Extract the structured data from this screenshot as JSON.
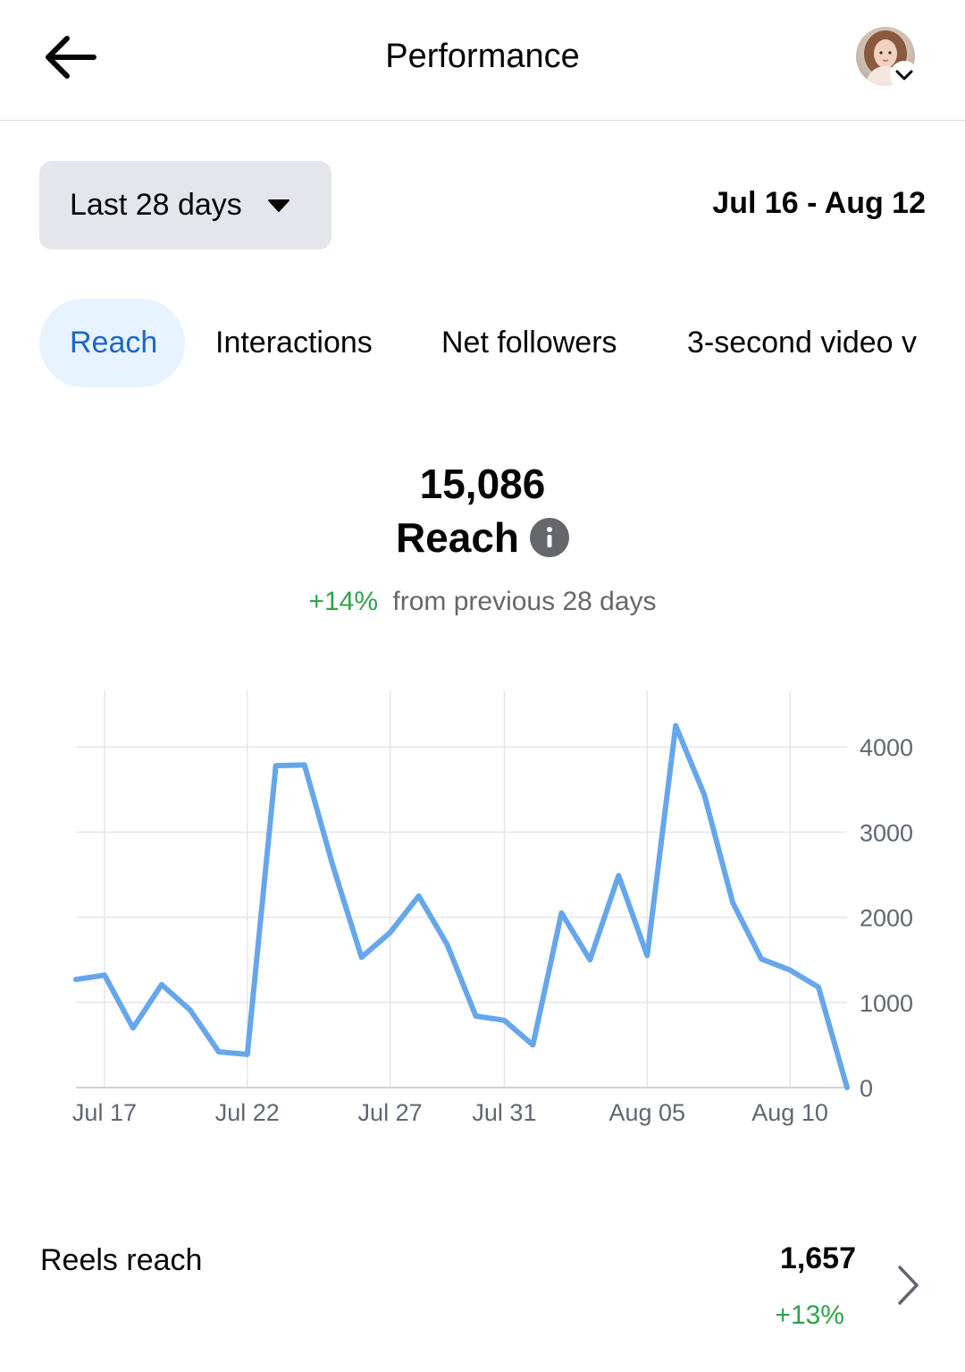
{
  "header": {
    "title": "Performance",
    "back_icon": "arrow-left-icon",
    "profile_menu_icon": "chevron-down-icon"
  },
  "filters": {
    "range_label": "Last 28 days",
    "date_range": "Jul 16 - Aug 12"
  },
  "tabs": [
    {
      "label": "Reach",
      "active": true
    },
    {
      "label": "Interactions",
      "active": false
    },
    {
      "label": "Net followers",
      "active": false
    },
    {
      "label": "3-second video v",
      "active": false
    }
  ],
  "metric": {
    "value": "15,086",
    "name": "Reach",
    "change_pct": "+14%",
    "change_text": "from previous 28 days"
  },
  "colors": {
    "accent": "#1b66c9",
    "active_tab_bg": "#e7f3ff",
    "positive": "#31a24c",
    "line": "#66a6ec"
  },
  "chart_data": {
    "type": "line",
    "x": [
      "Jul 16",
      "Jul 17",
      "Jul 18",
      "Jul 19",
      "Jul 20",
      "Jul 21",
      "Jul 22",
      "Jul 23",
      "Jul 24",
      "Jul 25",
      "Jul 26",
      "Jul 27",
      "Jul 28",
      "Jul 29",
      "Jul 30",
      "Jul 31",
      "Aug 01",
      "Aug 02",
      "Aug 03",
      "Aug 04",
      "Aug 05",
      "Aug 06",
      "Aug 07",
      "Aug 08",
      "Aug 09",
      "Aug 10",
      "Aug 11",
      "Aug 12"
    ],
    "series": [
      {
        "values": [
          1270,
          1320,
          700,
          1210,
          910,
          420,
          390,
          3780,
          3790,
          2600,
          1530,
          1820,
          2250,
          1680,
          840,
          790,
          500,
          2050,
          1500,
          2490,
          1550,
          4250,
          3440,
          2170,
          1510,
          1380,
          1180,
          0
        ]
      }
    ],
    "x_tick_labels": [
      "Jul 17",
      "Jul 22",
      "Jul 27",
      "Jul 31",
      "Aug 05",
      "Aug 10"
    ],
    "y_ticks": [
      0,
      1000,
      2000,
      3000,
      4000
    ],
    "ylim": [
      0,
      4500
    ],
    "grid": true,
    "y_axis_side": "right"
  },
  "summary": {
    "label": "Reels reach",
    "value": "1,657",
    "change": "+13%",
    "chevron_icon": "chevron-right-icon"
  }
}
